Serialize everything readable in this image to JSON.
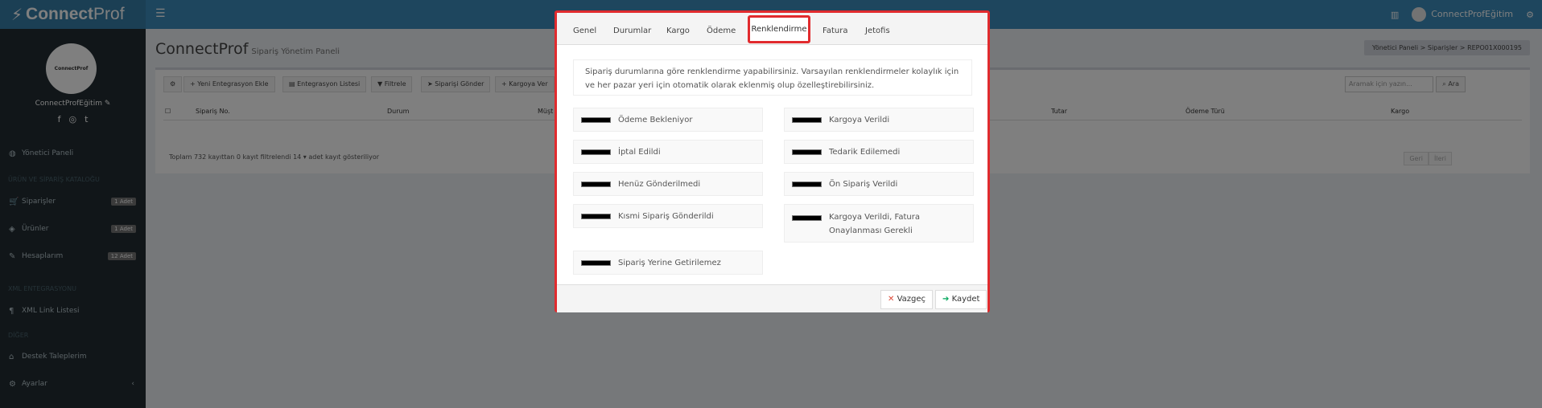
{
  "app": {
    "logo_text_bold": "Connect",
    "logo_text_rest": "Prof"
  },
  "topbar": {
    "user_name": "ConnectProfEğitim"
  },
  "sidebar": {
    "profile_logo_text": "ConnectProf",
    "profile_name": "ConnectProfEğitim",
    "items": [
      {
        "label": "Yönetici Paneli"
      },
      {
        "label": "Siparişler",
        "badge": "1 Adet"
      },
      {
        "label": "Ürünler",
        "badge": "1 Adet"
      },
      {
        "label": "Hesaplarım",
        "badge": "12 Adet"
      },
      {
        "label": "XML Link Listesi"
      },
      {
        "label": "Destek Taleplerim"
      },
      {
        "label": "Ayarlar"
      }
    ],
    "headers": [
      "ÜRÜN VE SİPARİŞ KATALOĞU",
      "XML ENTEGRASYONU",
      "DİĞER"
    ]
  },
  "page": {
    "title": "ConnectProf",
    "subtitle": "Sipariş Yönetim Paneli",
    "breadcrumb": [
      "Yönetici Paneli",
      "Siparişler",
      "REPO01X000195"
    ]
  },
  "toolbar": {
    "new_integration": "Yeni Entegrasyon Ekle",
    "integration_list": "Entegrasyon Listesi",
    "filter": "Filtrele",
    "send_order": "Siparişi Gönder",
    "cargo": "Kargoya Ver",
    "search_placeholder": "Aramak için yazın...",
    "search_button": "Ara"
  },
  "table": {
    "headers": [
      "Sipariş No.",
      "Durum",
      "Müşt",
      "Tutar",
      "Ödeme Türü",
      "Kargo"
    ],
    "paging_text": "Toplam 732 kayıttan 0 kayıt filtrelendi",
    "page_size": "14",
    "paging_suffix": "adet kayıt gösteriliyor",
    "prev": "Geri",
    "next": "İleri"
  },
  "modal": {
    "tabs": [
      "Genel",
      "Durumlar",
      "Kargo",
      "Ödeme",
      "Renklendirme",
      "Fatura",
      "Jetofis"
    ],
    "active_tab": "Renklendirme",
    "info_text": "Sipariş durumlarına göre renklendirme yapabilirsiniz. Varsayılan renklendirmeler kolaylık için ve her pazar yeri için otomatik olarak eklenmiş olup özelleştirebilirsiniz.",
    "statuses": [
      {
        "label": "Ödeme Bekleniyor",
        "color": "#000000"
      },
      {
        "label": "Kargoya Verildi",
        "color": "#000000"
      },
      {
        "label": "İptal Edildi",
        "color": "#000000"
      },
      {
        "label": "Tedarik Edilemedi",
        "color": "#000000"
      },
      {
        "label": "Henüz Gönderilmedi",
        "color": "#000000"
      },
      {
        "label": "Ön Sipariş Verildi",
        "color": "#000000"
      },
      {
        "label": "Kısmi Sipariş Gönderildi",
        "color": "#000000"
      },
      {
        "label": "Kargoya Verildi, Fatura Onaylanması Gerekli",
        "color": "#000000"
      },
      {
        "label": "Sipariş Yerine Getirilemez",
        "color": "#000000"
      }
    ],
    "cancel_label": "Vazgeç",
    "save_label": "Kaydet"
  },
  "colors": {
    "accent": "#3c8dbc",
    "highlight": "#e12b2e",
    "sidebar": "#222d32"
  }
}
